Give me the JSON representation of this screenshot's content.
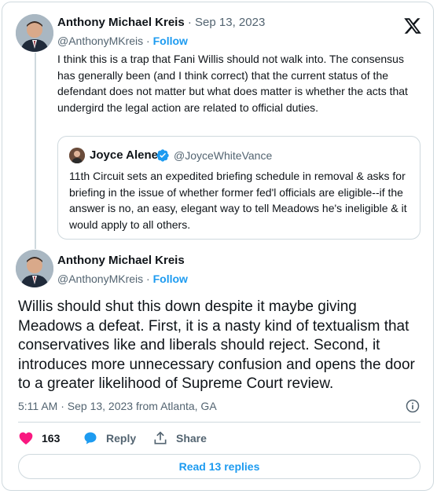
{
  "tweet1": {
    "author_name": "Anthony Michael Kreis",
    "separator": "·",
    "date": "Sep 13, 2023",
    "handle": "@AnthonyMKreis",
    "dot": "·",
    "follow_label": "Follow",
    "text": "I think this is a trap that Fani Willis should not walk into. The consensus has generally been (and I think correct) that the current status of the defendant does not matter but what does matter is whether the acts that undergird the legal action are related to official duties."
  },
  "quote": {
    "author_name": "Joyce Alene",
    "handle": "@JoyceWhiteVance",
    "text": "11th Circuit sets an expedited briefing schedule in removal & asks for briefing in the issue of whether former fed'l officials are eligible--if the answer is no, an easy, elegant way to tell Meadows he's ineligible & it would apply to all others."
  },
  "tweet2": {
    "author_name": "Anthony Michael Kreis",
    "handle": "@AnthonyMKreis",
    "dot": "·",
    "follow_label": "Follow",
    "text": "Willis should shut this down despite it maybe giving Meadows a defeat. First, it is a nasty kind of textualism that conservatives like and liberals should reject. Second, it introduces more unnecessary confusion and opens the door to a greater likelihood of Supreme Court review.",
    "timestamp": "5:11 AM · Sep 13, 2023 from Atlanta, GA"
  },
  "actions": {
    "like_count": "163",
    "reply_label": "Reply",
    "share_label": "Share"
  },
  "read_replies_label": "Read 13 replies",
  "colors": {
    "accent": "#1d9bf0",
    "like": "#f91880",
    "text": "#0f1419",
    "muted": "#536471",
    "border": "#cfd9de"
  }
}
